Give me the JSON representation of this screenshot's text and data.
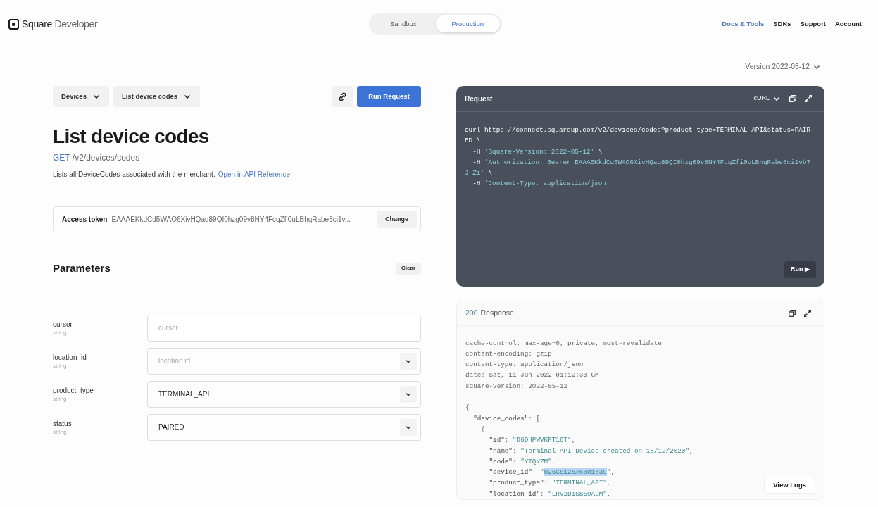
{
  "header": {
    "logo": "Square",
    "logo_suffix": "Developer",
    "environments": [
      {
        "label": "Sandbox",
        "selected": false
      },
      {
        "label": "Production",
        "selected": true
      }
    ],
    "nav": [
      {
        "label": "Docs & Tools",
        "selected": true
      },
      {
        "label": "SDKs",
        "selected": false
      },
      {
        "label": "Support",
        "selected": false
      },
      {
        "label": "Account",
        "selected": false
      }
    ]
  },
  "breadcrumbs": [
    "Devices",
    "List device codes"
  ],
  "run_button": "Run Request",
  "title": "List device codes",
  "method": "GET",
  "path": "/v2/devices/codes",
  "description": "Lists all DeviceCodes associated with the merchant.",
  "reference_link": "Open in API Reference",
  "access_token": {
    "label": "Access token",
    "value": "EAAAEKkdCd5WAO6XivHQaq89QI0hzg09v8NY4FcqZfi0uLBhqRabe8ci1v...",
    "button": "Change"
  },
  "parameters": {
    "title": "Parameters",
    "clear": "Clear",
    "items": [
      {
        "name": "cursor",
        "type": "string",
        "kind": "text",
        "placeholder": "cursor"
      },
      {
        "name": "location_id",
        "type": "string",
        "kind": "select",
        "placeholder": "location id"
      },
      {
        "name": "product_type",
        "type": "string",
        "kind": "select",
        "value": "TERMINAL_API"
      },
      {
        "name": "status",
        "type": "string",
        "kind": "select",
        "value": "PAIRED"
      }
    ]
  },
  "version": "Version 2022-05-12",
  "request": {
    "title": "Request",
    "language": "cURL",
    "run": "Run ▶",
    "lines": [
      [
        {
          "text": "curl https://connect.squareup.com/v2/devices/codes?product_type=TERMINAL_API&status=PAIR",
          "kind": "plain"
        }
      ],
      [
        {
          "text": "ED \\",
          "kind": "plain"
        }
      ],
      [
        {
          "text": "  -H ",
          "kind": "plain"
        },
        {
          "text": "'Square-Version: 2022-05-12'",
          "kind": "string"
        },
        {
          "text": " \\",
          "kind": "plain"
        }
      ],
      [
        {
          "text": "  -H ",
          "kind": "plain"
        },
        {
          "text": "'Authorization: Bearer EAAAEKkdCd5WAO6XivHQaq89QI0hzg09v8NY4FcqZfi0uLBhqRabe8ci1vb7",
          "kind": "string"
        }
      ],
      [
        {
          "text": "J_Zi'",
          "kind": "string"
        },
        {
          "text": " \\",
          "kind": "plain"
        }
      ],
      [
        {
          "text": "  -H ",
          "kind": "plain"
        },
        {
          "text": "'Content-Type: application/json'",
          "kind": "string"
        }
      ]
    ]
  },
  "response": {
    "status": "200",
    "title": "Response",
    "view_logs": "View Logs",
    "header_lines": [
      [
        {
          "text": "cache-control: max-age=0, private, must-revalidate",
          "kind": "plain"
        }
      ],
      [
        {
          "text": "content-encoding: gzip",
          "kind": "plain"
        }
      ],
      [
        {
          "text": "content-type: application/json",
          "kind": "plain"
        }
      ],
      [
        {
          "text": "date: Sat, 11 Jun 2022 01:12:33 GMT",
          "kind": "plain"
        }
      ],
      [
        {
          "text": "square-version: 2022-05-12",
          "kind": "plain"
        }
      ]
    ],
    "body_lines": [
      [
        {
          "text": "{",
          "kind": "plain"
        }
      ],
      [
        {
          "text": "  \"device_codes\"",
          "kind": "key"
        },
        {
          "text": ": [",
          "kind": "plain"
        }
      ],
      [
        {
          "text": "    {",
          "kind": "plain"
        }
      ],
      [
        {
          "text": "      \"id\"",
          "kind": "key"
        },
        {
          "text": ": ",
          "kind": "plain"
        },
        {
          "text": "\"D6DHPWVKPT16T\"",
          "kind": "string"
        },
        {
          "text": ",",
          "kind": "plain"
        }
      ],
      [
        {
          "text": "      \"name\"",
          "kind": "key"
        },
        {
          "text": ": ",
          "kind": "plain"
        },
        {
          "text": "\"Terminal API Device created on 18/12/2020\"",
          "kind": "string"
        },
        {
          "text": ",",
          "kind": "plain"
        }
      ],
      [
        {
          "text": "      \"code\"",
          "kind": "key"
        },
        {
          "text": ": ",
          "kind": "plain"
        },
        {
          "text": "\"YTQYZM\"",
          "kind": "string"
        },
        {
          "text": ",",
          "kind": "plain"
        }
      ],
      [
        {
          "text": "      \"device_id\"",
          "kind": "key"
        },
        {
          "text": ": ",
          "kind": "plain"
        },
        {
          "text": "\"",
          "kind": "string"
        },
        {
          "text": "025CS126A6001039",
          "kind": "selected"
        },
        {
          "text": "\"",
          "kind": "string"
        },
        {
          "text": ",",
          "kind": "plain"
        }
      ],
      [
        {
          "text": "      \"product_type\"",
          "kind": "key"
        },
        {
          "text": ": ",
          "kind": "plain"
        },
        {
          "text": "\"TERMINAL_API\"",
          "kind": "string"
        },
        {
          "text": ",",
          "kind": "plain"
        }
      ],
      [
        {
          "text": "      \"location_id\"",
          "kind": "key"
        },
        {
          "text": ": ",
          "kind": "plain"
        },
        {
          "text": "\"LRV2D1SB59ADM\"",
          "kind": "string"
        },
        {
          "text": ",",
          "kind": "plain"
        }
      ]
    ]
  }
}
